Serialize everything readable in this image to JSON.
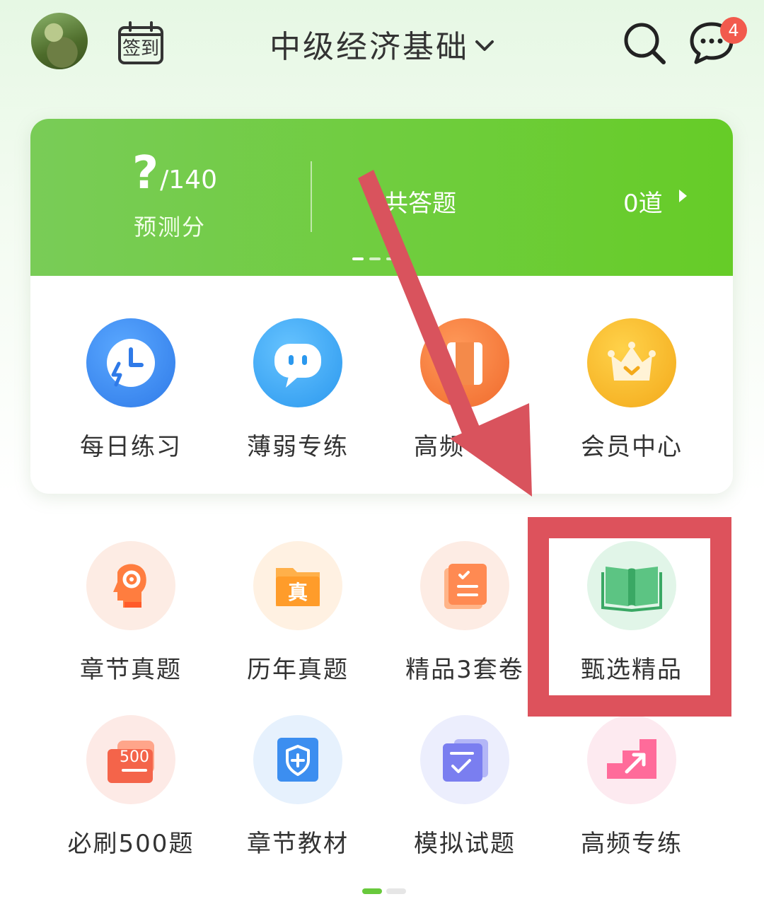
{
  "header": {
    "signin_label": "签到",
    "title": "中级经济基础",
    "message_badge": "4"
  },
  "stats": {
    "score_value": "?",
    "score_total": "/140",
    "score_label": "预测分",
    "answered_label": "共答题",
    "answered_count": "0道"
  },
  "main_features": [
    {
      "label": "每日练习",
      "icon": "clock-lightning-icon",
      "color": "#3a8cf0"
    },
    {
      "label": "薄弱专练",
      "icon": "chat-face-icon",
      "color": "#38a6f2"
    },
    {
      "label": "高频考点",
      "icon": "bookmark-icon",
      "color": "#f47a3c"
    },
    {
      "label": "会员中心",
      "icon": "crown-icon",
      "color": "#f5b41f"
    }
  ],
  "grid": [
    {
      "label": "章节真题",
      "icon": "head-gear-icon"
    },
    {
      "label": "历年真题",
      "icon": "folder-zhen-icon"
    },
    {
      "label": "精品3套卷",
      "icon": "checklist-doc-icon"
    },
    {
      "label": "甄选精品",
      "icon": "open-book-icon"
    },
    {
      "label": "必刷500题",
      "icon": "scroll-500-icon"
    },
    {
      "label": "章节教材",
      "icon": "shield-plus-icon"
    },
    {
      "label": "模拟试题",
      "icon": "check-scroll-icon"
    },
    {
      "label": "高频专练",
      "icon": "stairs-arrow-icon"
    }
  ],
  "grid_badges": {
    "zhen": "真",
    "five_hundred": "500"
  },
  "colors": {
    "green": "#6fcd3d",
    "highlight_red": "#dd525c",
    "badge_red": "#f25a4d"
  }
}
